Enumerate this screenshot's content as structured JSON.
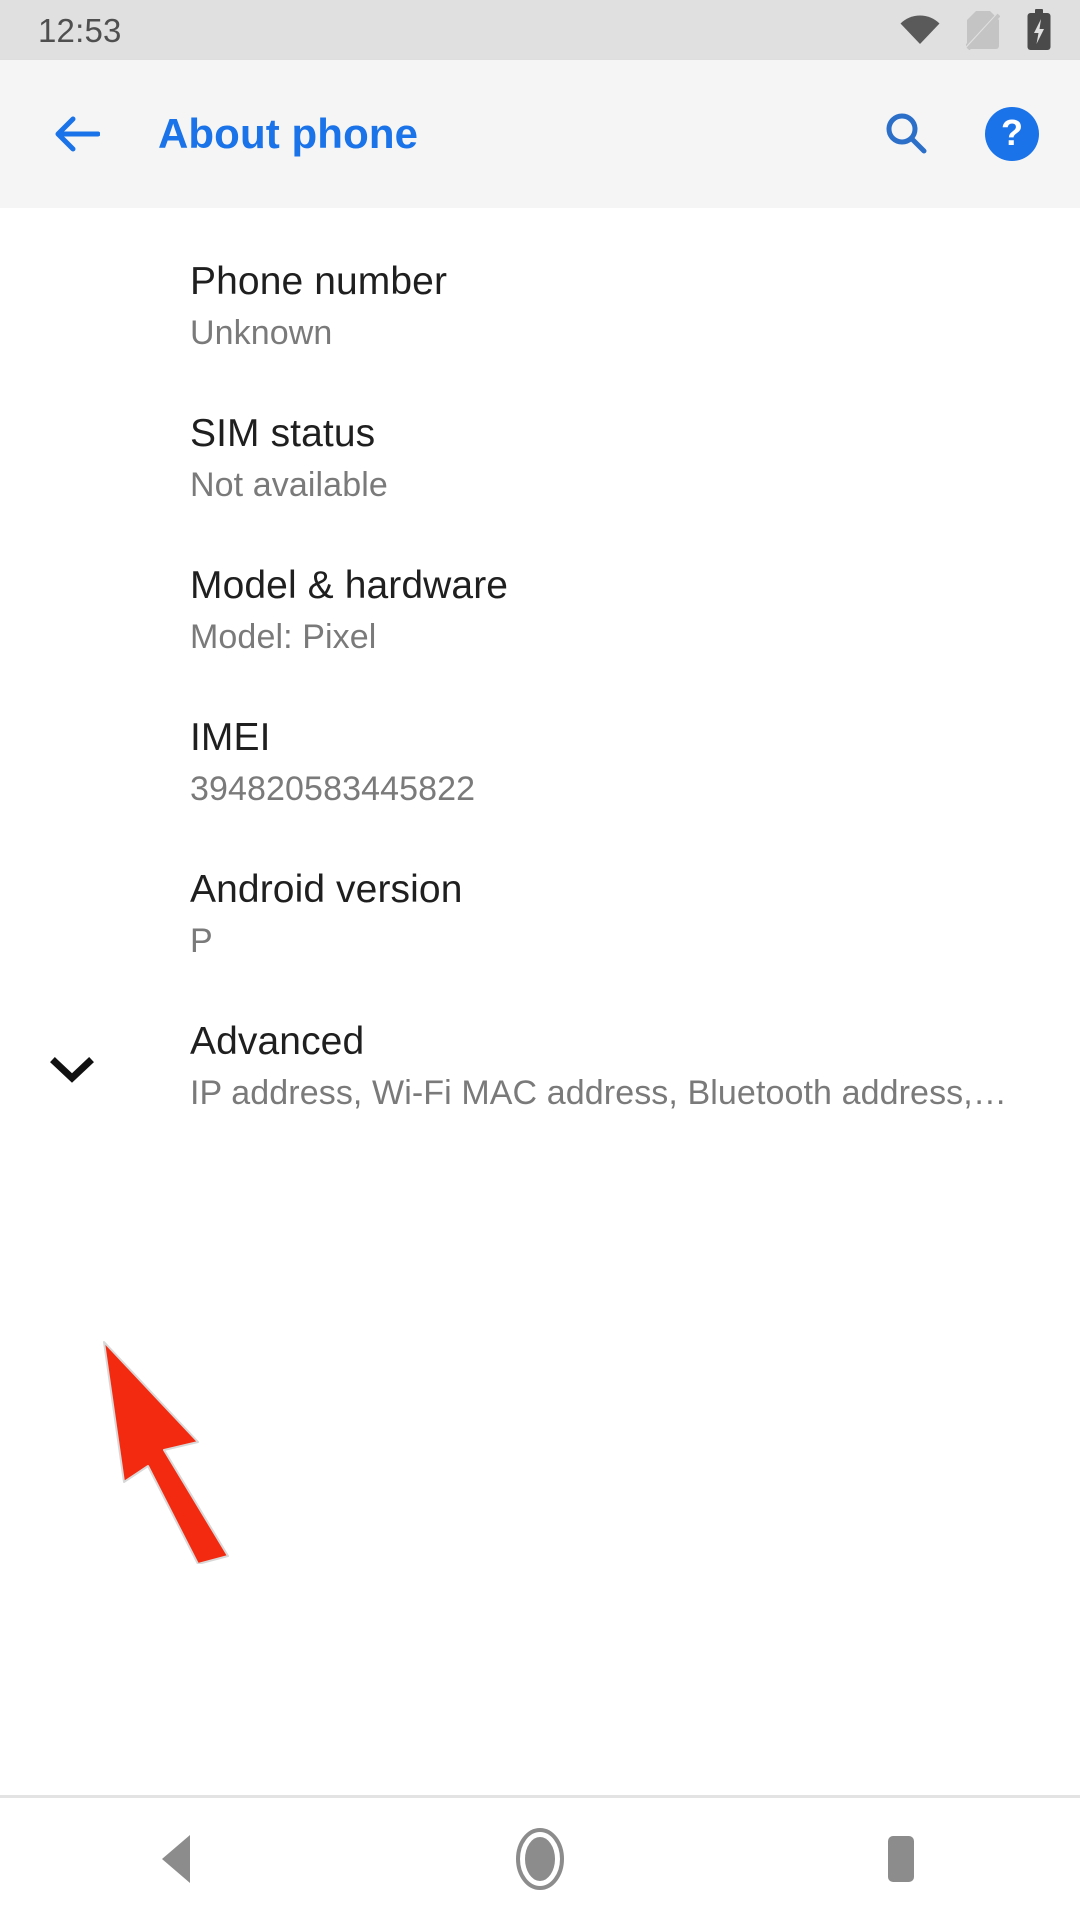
{
  "status_bar": {
    "clock": "12:53",
    "icons": [
      {
        "name": "wifi-icon",
        "label": "Wi-Fi signal full"
      },
      {
        "name": "no-sim-icon",
        "label": "No SIM card"
      },
      {
        "name": "battery-charging-icon",
        "label": "Battery charging"
      }
    ]
  },
  "app_bar": {
    "back_label": "Back",
    "title": "About phone",
    "search_label": "Search",
    "help_label": "?",
    "accent_color": "#1a73e8"
  },
  "settings_list": [
    {
      "title": "Phone number",
      "summary": "Unknown",
      "expandable": false
    },
    {
      "title": "SIM status",
      "summary": "Not available",
      "expandable": false
    },
    {
      "title": "Model & hardware",
      "summary": "Model: Pixel",
      "expandable": false
    },
    {
      "title": "IMEI",
      "summary": "394820583445822",
      "expandable": false
    },
    {
      "title": "Android version",
      "summary": "P",
      "expandable": false
    },
    {
      "title": "Advanced",
      "summary": "IP address, Wi-Fi MAC address, Bluetooth address,…",
      "expandable": true
    }
  ],
  "annotation": {
    "arrow_color": "#f42a10",
    "points_to": "Advanced expand chevron"
  },
  "nav_bar": {
    "back_label": "Back",
    "home_label": "Home",
    "recents_label": "Recents",
    "icon_color": "#8c8c8c"
  }
}
